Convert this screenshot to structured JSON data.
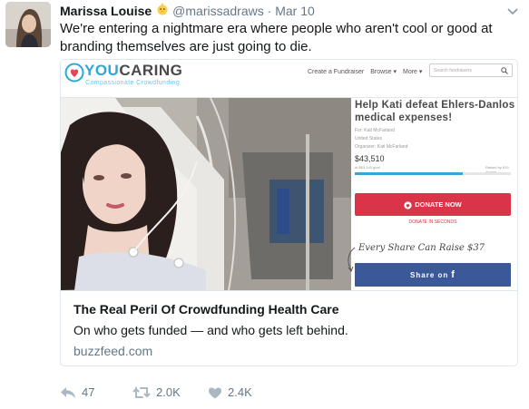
{
  "tweet": {
    "author_name": "Marissa Louise",
    "emoji_icon": "baby-chick-icon",
    "handle": "@marissadraws",
    "separator": "·",
    "time": "Mar 10",
    "text": "We're entering a nightmare era where people who aren't cool or good at branding themselves are just going to die."
  },
  "card": {
    "preview": {
      "logo_text_1": "YOU",
      "logo_text_2": "CARING",
      "tagline": "Compassionate Crowdfunding",
      "nav": [
        "Create a Fundraiser",
        "Browse ▾",
        "More ▾"
      ],
      "search_placeholder": "Search fundraisers",
      "title": "Help Kati defeat Ehlers-Danlos medical expenses!",
      "for_line": "For: Kati McFarland",
      "location": "United States",
      "organizer": "Organizer: Kati McFarland",
      "amount": "$43,510",
      "goal": "of $63,143 goal",
      "raised_by": "Raised by 619 donors",
      "progress_fraction": 0.69,
      "donate_label": "DONATE NOW",
      "donate_sub": "DONATE IN SECONDS",
      "every_share": "Every Share Can Raise $37",
      "share_label": "Share on",
      "share_icon": "facebook-f-icon",
      "accent_color": "#2ba8d9",
      "donate_color": "#d93447",
      "facebook_color": "#3b5998"
    },
    "title": "The Real Peril Of Crowdfunding Health Care",
    "description": "On who gets funded — and who gets left behind.",
    "domain": "buzzfeed.com"
  },
  "actions": {
    "reply_count": "47",
    "retweet_count": "2.0K",
    "like_count": "2.4K"
  },
  "colors": {
    "secondary_text": "#657786",
    "border": "#e1e8ed"
  }
}
